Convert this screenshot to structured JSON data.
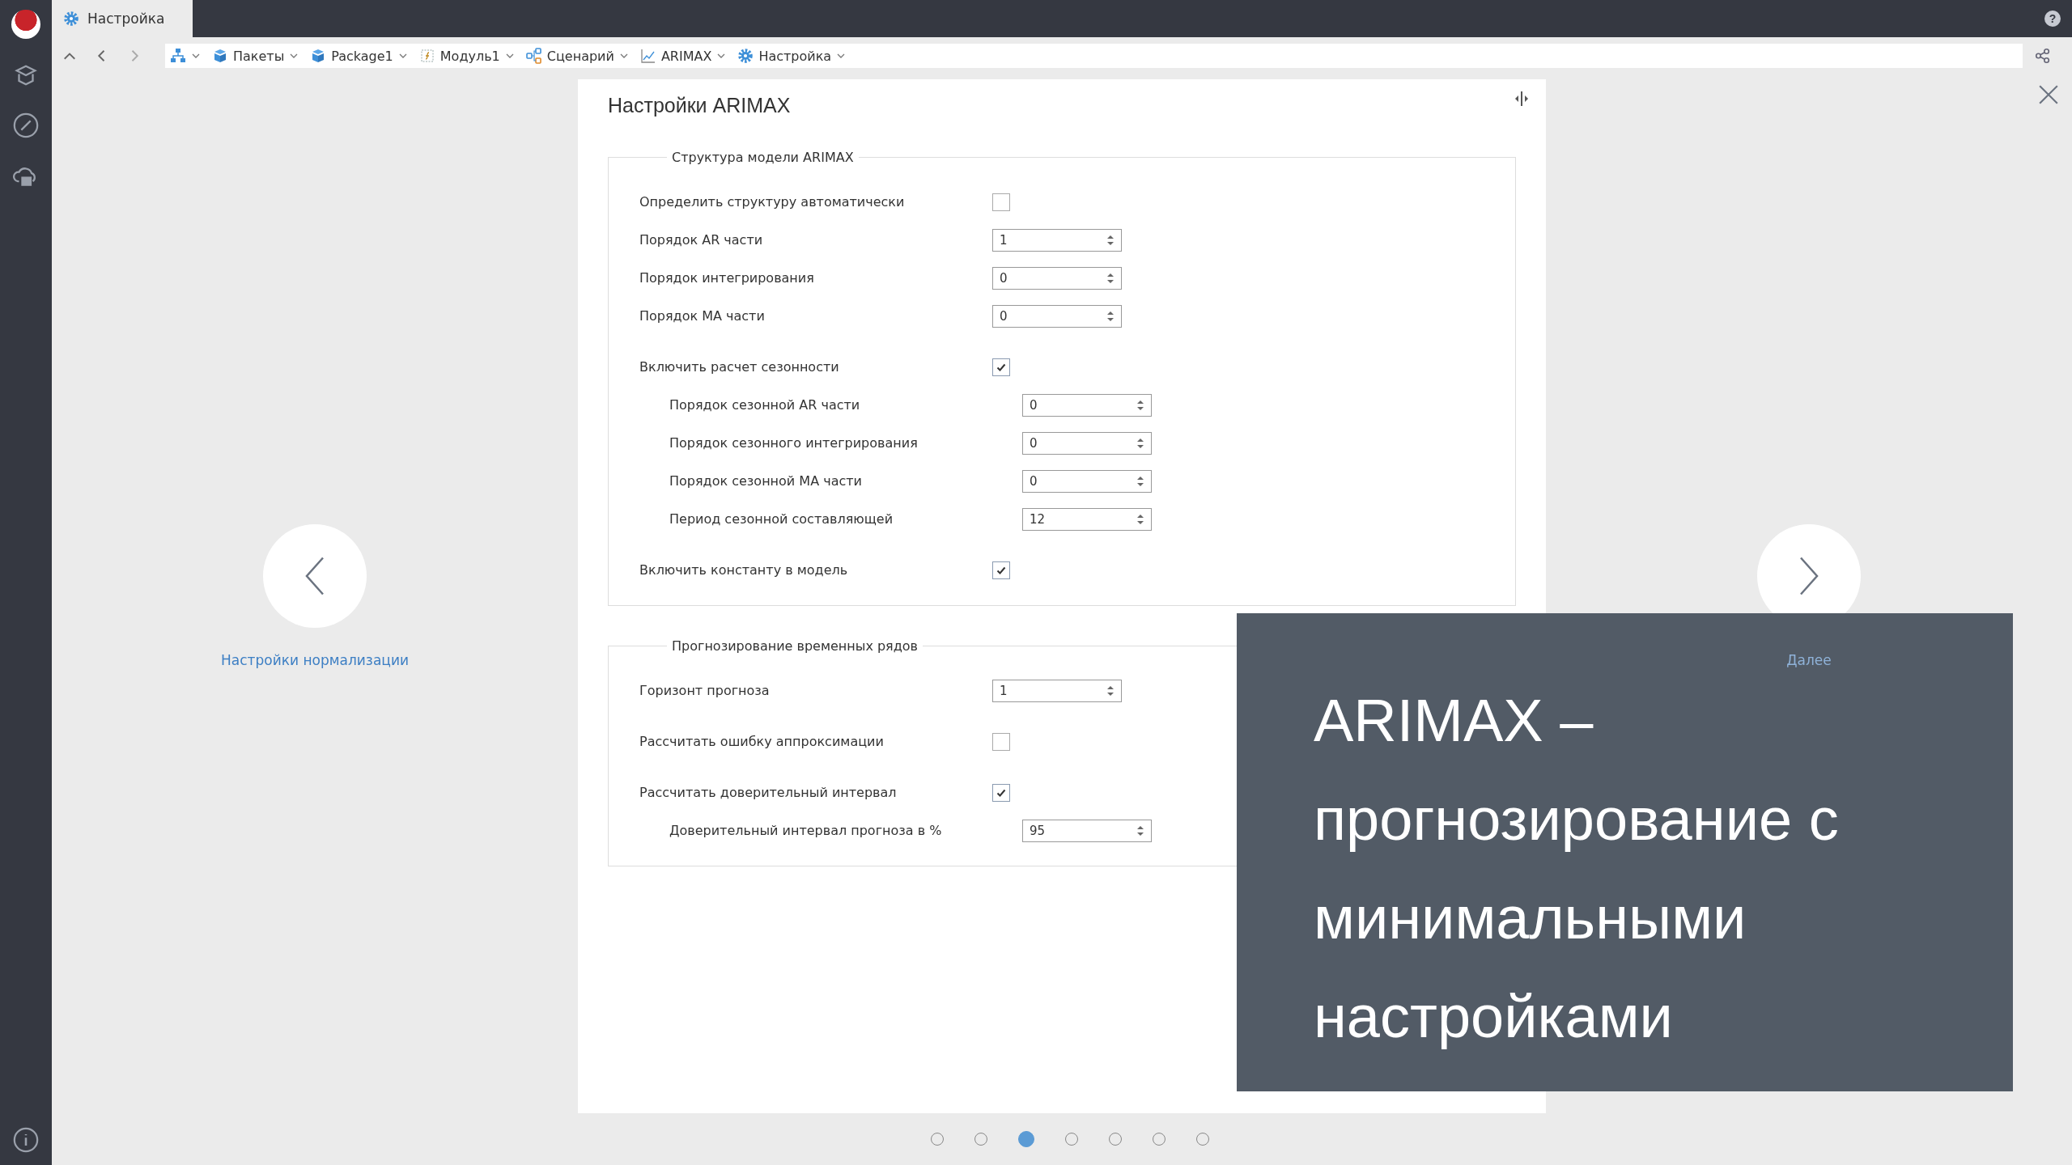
{
  "window": {
    "tab": {
      "label": "Настройка",
      "selected": true
    },
    "help": {
      "label": "?"
    }
  },
  "breadcrumbs": [
    {
      "kind": "hierarchy"
    },
    {
      "kind": "package",
      "label": "Пакеты"
    },
    {
      "kind": "package",
      "label": "Package1"
    },
    {
      "kind": "module",
      "label": "Модуль1"
    },
    {
      "kind": "scenario",
      "label": "Сценарий"
    },
    {
      "kind": "chart",
      "label": "ARIMAX"
    },
    {
      "kind": "gear",
      "label": "Настройка"
    }
  ],
  "panel": {
    "title": "Настройки ARIMAX",
    "sections": [
      {
        "legend": "Структура модели ARIMAX",
        "rows": [
          {
            "kind": "checkbox",
            "label": "Определить структуру автоматически",
            "checked": false
          },
          {
            "kind": "number",
            "label": "Порядок AR части",
            "value": "1"
          },
          {
            "kind": "number",
            "label": "Порядок интегрирования",
            "value": "0"
          },
          {
            "kind": "number",
            "label": "Порядок MA части",
            "value": "0"
          },
          {
            "kind": "checkbox",
            "label": "Включить расчет сезонности",
            "checked": true,
            "children": [
              {
                "kind": "number",
                "label": "Порядок сезонной AR части",
                "value": "0"
              },
              {
                "kind": "number",
                "label": "Порядок сезонного интегрирования",
                "value": "0"
              },
              {
                "kind": "number",
                "label": "Порядок сезонной MA части",
                "value": "0"
              },
              {
                "kind": "number",
                "label": "Период сезонной составляющей",
                "value": "12"
              }
            ]
          },
          {
            "kind": "checkbox",
            "label": "Включить константу в модель",
            "checked": true
          }
        ]
      },
      {
        "legend": "Прогнозирование временных рядов",
        "rows": [
          {
            "kind": "number",
            "label": "Горизонт прогноза",
            "value": "1"
          },
          {
            "kind": "checkbox",
            "label": "Рассчитать ошибку аппроксимации",
            "checked": false
          },
          {
            "kind": "checkbox",
            "label": "Рассчитать доверительный интервал",
            "checked": true,
            "children": [
              {
                "kind": "number",
                "label": "Доверительный интервал прогноза в %",
                "value": "95"
              }
            ]
          }
        ]
      }
    ]
  },
  "nav": {
    "prev": {
      "label": "Настройки нормализации"
    },
    "next": {
      "label": "Далее"
    }
  },
  "overlay": {
    "text": "ARIMAX – прогнозирование с минимальными настройками"
  },
  "pager": [
    {
      "selected": false
    },
    {
      "selected": false
    },
    {
      "selected": true
    },
    {
      "selected": false
    },
    {
      "selected": false
    },
    {
      "selected": false
    },
    {
      "selected": false
    }
  ]
}
